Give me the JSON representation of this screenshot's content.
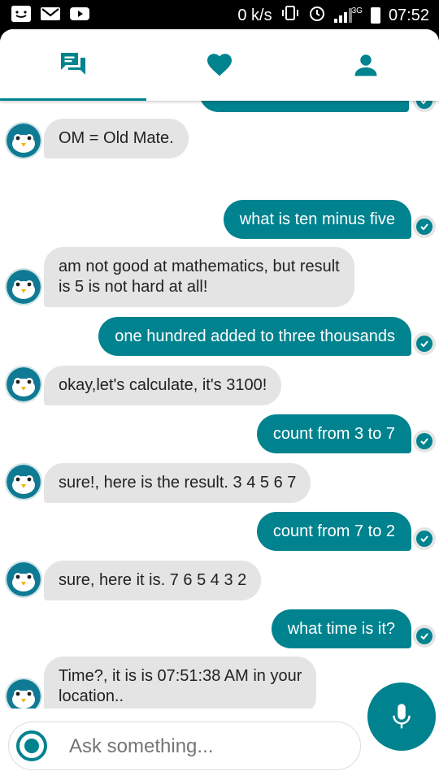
{
  "status_bar": {
    "network_speed": "0 k/s",
    "network_type": "3G",
    "time": "07:52",
    "icons": [
      "sms-icon",
      "gmail-icon",
      "youtube-icon",
      "vibrate-icon",
      "alarm-icon",
      "signal-icon",
      "battery-icon"
    ]
  },
  "tabs": [
    {
      "name": "chat",
      "icon": "chat-icon",
      "active": true
    },
    {
      "name": "favorites",
      "icon": "heart-icon",
      "active": false
    },
    {
      "name": "profile",
      "icon": "person-icon",
      "active": false
    }
  ],
  "colors": {
    "accent": "#00838F",
    "bot_bubble": "#E4E4E4",
    "background": "#FFFFFF"
  },
  "messages": [
    {
      "from": "bot",
      "text": "OM = Old Mate."
    },
    {
      "from": "user",
      "text": "what is ten minus five"
    },
    {
      "from": "bot",
      "lines": [
        "am not good at mathematics, but result",
        "is 5 is not hard at all!"
      ]
    },
    {
      "from": "user",
      "text": "one hundred added to three thousands"
    },
    {
      "from": "bot",
      "text": "okay,let's calculate, it's 3100!"
    },
    {
      "from": "user",
      "text": "count from 3 to 7"
    },
    {
      "from": "bot",
      "text": "sure!, here is the result. 3 4 5 6 7"
    },
    {
      "from": "user",
      "text": "count from 7 to 2"
    },
    {
      "from": "bot",
      "text": "sure, here it is. 7 6 5 4 3 2"
    },
    {
      "from": "user",
      "text": "what time is it?"
    },
    {
      "from": "bot",
      "lines": [
        "Time?, it is is 07:51:38 AM in your",
        "location.."
      ]
    }
  ],
  "input": {
    "placeholder": "Ask something...",
    "value": ""
  }
}
